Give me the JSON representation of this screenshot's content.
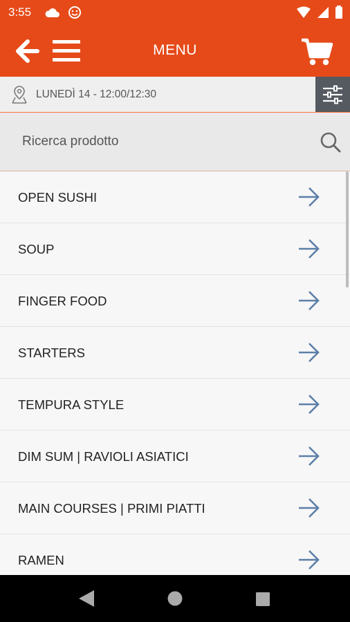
{
  "status": {
    "time": "3:55",
    "left_icons": [
      "cloud-icon",
      "smiley-icon"
    ],
    "right_icons": [
      "wifi-icon",
      "signal-icon",
      "battery-icon"
    ]
  },
  "appbar": {
    "title": "MENU",
    "back_icon": "arrow-left-icon",
    "menu_icon": "hamburger-icon",
    "cart_icon": "cart-icon"
  },
  "delivery": {
    "text": "LUNEDÌ 14 - 12:00/12:30",
    "location_icon": "location-pin-icon",
    "filter_icon": "sliders-icon"
  },
  "search": {
    "placeholder": "Ricerca prodotto",
    "icon": "search-icon"
  },
  "categories": [
    {
      "label": "OPEN SUSHI"
    },
    {
      "label": "SOUP"
    },
    {
      "label": "FINGER FOOD"
    },
    {
      "label": "STARTERS"
    },
    {
      "label": "TEMPURA STYLE"
    },
    {
      "label": "DIM SUM | RAVIOLI ASIATICI"
    },
    {
      "label": "MAIN COURSES | PRIMI PIATTI"
    },
    {
      "label": "RAMEN"
    }
  ],
  "colors": {
    "primary": "#e64a19",
    "arrow": "#5c7fa8",
    "filter_bg": "#545a60"
  },
  "navbar": {
    "buttons": [
      "back-nav-icon",
      "home-nav-icon",
      "recents-nav-icon"
    ]
  }
}
